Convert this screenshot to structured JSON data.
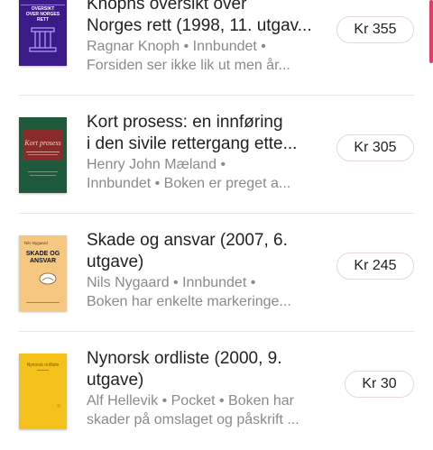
{
  "books": [
    {
      "title_line1": "Knophs oversikt over",
      "title_line2": "Norges rett (1998, 11. utgav...",
      "meta_line1": "Ragnar Knoph • Innbundet •",
      "meta_line2": "Forsiden ser ikke lik ut men år...",
      "price": "Kr 355",
      "cover_text": "OVERSIKT OVER NORGES RETT",
      "cover_color": "#3b1a8a"
    },
    {
      "title_line1": "Kort prosess: en innføring",
      "title_line2": "i den sivile rettergang ette...",
      "meta_line1": "Henry John Mæland •",
      "meta_line2": "Innbundet • Boken er preget a...",
      "price": "Kr 305",
      "cover_text": "Kort prosess",
      "cover_color": "#1f5a3c"
    },
    {
      "title_line1": "Skade og ansvar (2007, 6.",
      "title_line2": "utgave)",
      "meta_line1": "Nils Nygaard • Innbundet •",
      "meta_line2": "Boken har enkelte markeringe...",
      "price": "Kr 245",
      "cover_author": "Nils Nygaard",
      "cover_text": "SKADE OG ANSVAR",
      "cover_color": "#f5c780"
    },
    {
      "title_line1": "Nynorsk ordliste (2000, 9.",
      "title_line2": "utgave)",
      "meta_line1": "Alf Hellevik • Pocket • Boken har",
      "meta_line2": "skader på omslaget og påskrift ...",
      "price": "Kr 30",
      "cover_text": "Nynorsk ordliste",
      "cover_color": "#f4c21a"
    }
  ],
  "accent_color": "#e53a6a"
}
